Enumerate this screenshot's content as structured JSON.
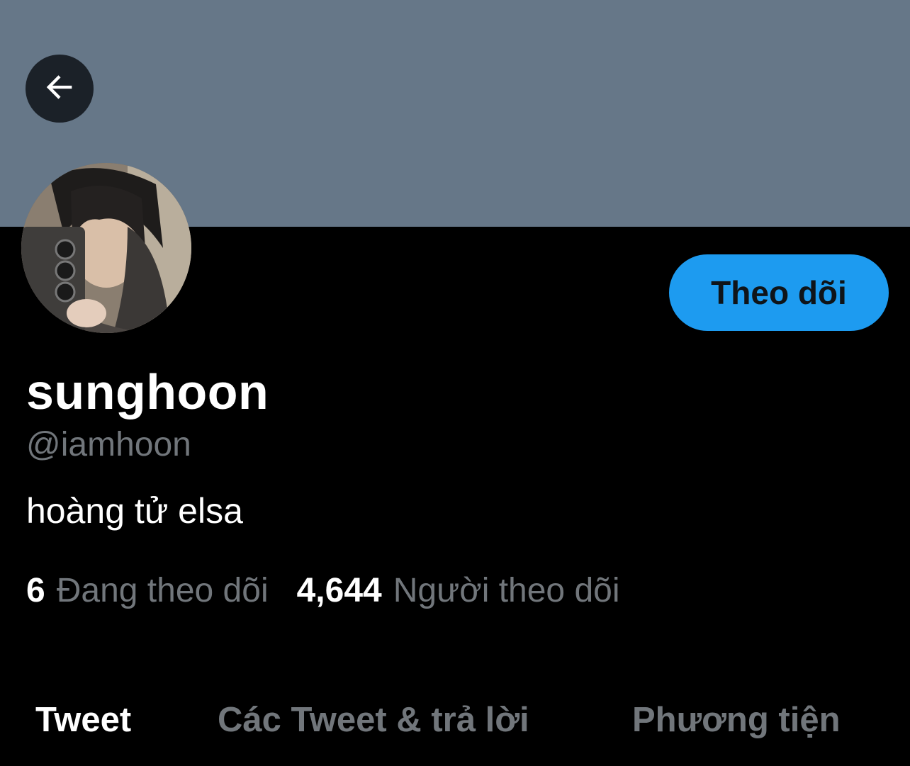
{
  "header": {
    "back_icon": "arrow-left-icon"
  },
  "profile": {
    "avatar_alt": "profile photo",
    "follow_label": "Theo dõi",
    "display_name": "sunghoon",
    "handle": "@iamhoon",
    "bio": "hoàng tử elsa"
  },
  "stats": {
    "following_count": "6",
    "following_label": "Đang theo dõi",
    "followers_count": "4,644",
    "followers_label": "Người theo dõi"
  },
  "tabs": [
    {
      "label": "Tweet",
      "active": true
    },
    {
      "label": "Các Tweet & trả lời",
      "active": false
    },
    {
      "label": "Phương tiện",
      "active": false
    }
  ],
  "colors": {
    "banner": "#667788",
    "background": "#000000",
    "accent": "#1d9bf0",
    "muted_text": "#71767b"
  }
}
